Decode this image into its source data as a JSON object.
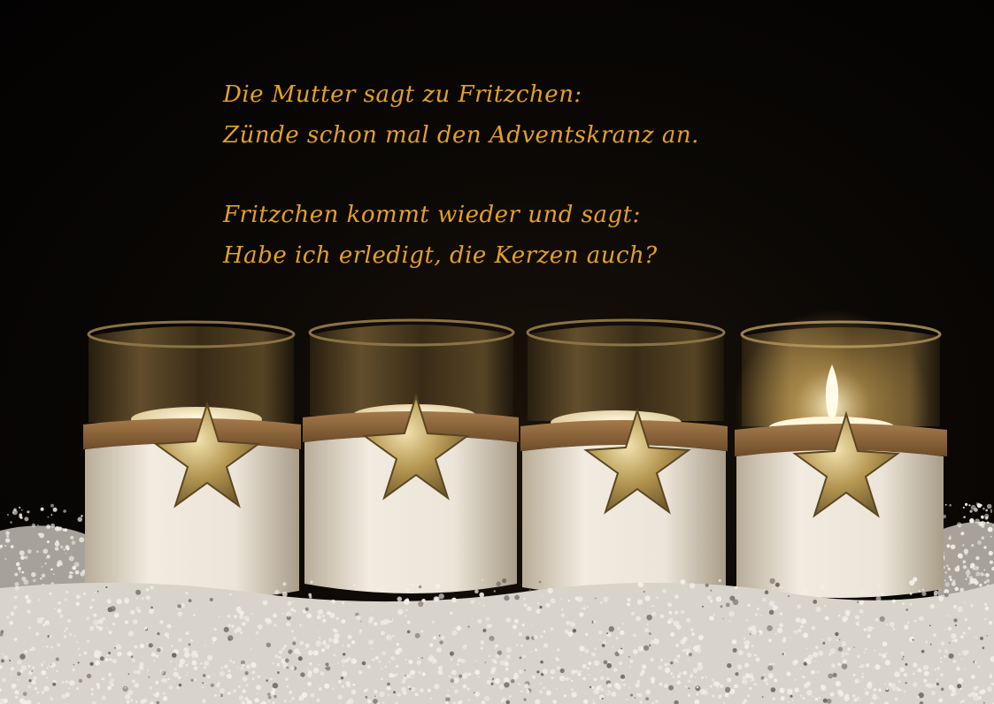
{
  "joke": {
    "line1": "Die Mutter sagt zu Fritzchen:",
    "line2": "Zünde schon mal den Adventskranz an.",
    "line3": "Fritzchen kommt wieder und sagt:",
    "line4": "Habe ich erledigt, die Kerzen auch?"
  },
  "colors": {
    "text": "#e4a020",
    "background": "#050403",
    "snow": "#f2efe9",
    "felt": "#ebe4d8",
    "band": "#8a6238",
    "star": "#c7a962",
    "glass": "#4a3a1c"
  },
  "candles": [
    {
      "name": "candle-holder-1",
      "lit": false
    },
    {
      "name": "candle-holder-2",
      "lit": false
    },
    {
      "name": "candle-holder-3",
      "lit": false
    },
    {
      "name": "candle-holder-4",
      "lit": true
    }
  ],
  "icons": [
    "star-icon",
    "flame-icon"
  ]
}
